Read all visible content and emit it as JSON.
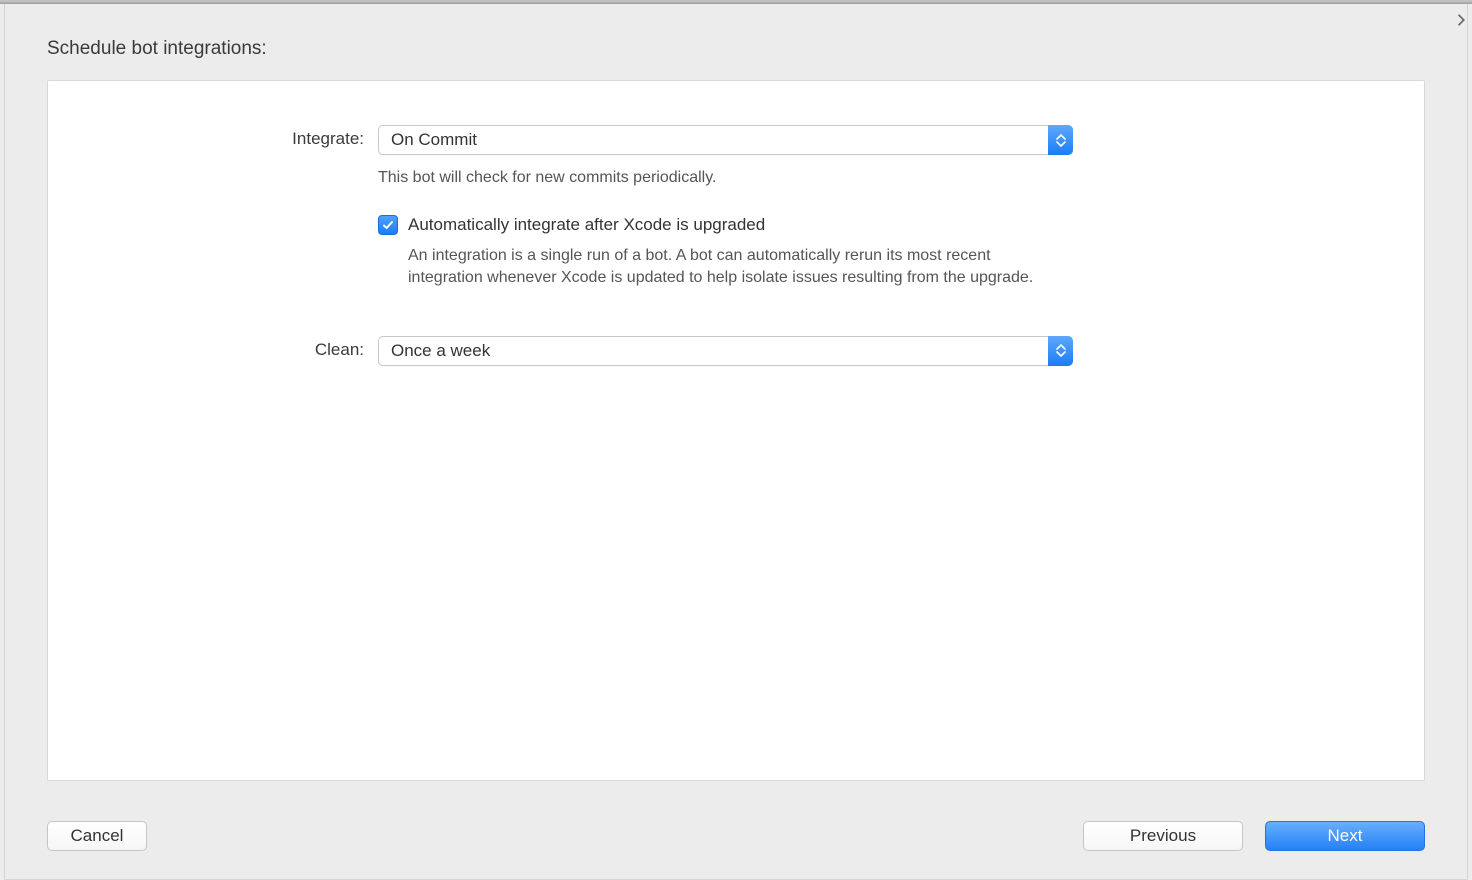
{
  "dialog": {
    "title": "Schedule bot integrations:"
  },
  "form": {
    "integrate": {
      "label": "Integrate:",
      "value": "On Commit",
      "hint": "This bot will check for new commits periodically."
    },
    "auto_integrate": {
      "checked": true,
      "label": "Automatically integrate after Xcode is upgraded",
      "description": "An integration is a single run of a bot. A bot can automatically rerun its most recent integration whenever Xcode is updated to help isolate issues resulting from the upgrade."
    },
    "clean": {
      "label": "Clean:",
      "value": "Once a week"
    }
  },
  "buttons": {
    "cancel": "Cancel",
    "previous": "Previous",
    "next": "Next"
  }
}
